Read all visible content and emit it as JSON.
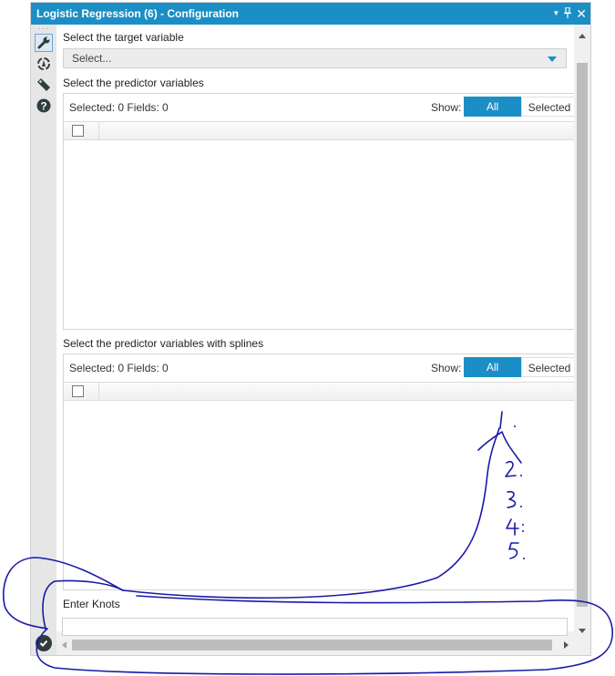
{
  "window": {
    "title": "Logistic Regression (6) - Configuration",
    "controls": [
      "dropdown-icon",
      "pin-icon",
      "close-icon"
    ],
    "accent_color": "#1b8fc5"
  },
  "left_tools": [
    {
      "icon": "wrench-icon",
      "active": true
    },
    {
      "icon": "connection-icon",
      "active": false
    },
    {
      "icon": "tag-icon",
      "active": false
    },
    {
      "icon": "help-icon",
      "active": false
    }
  ],
  "target": {
    "label": "Select the target variable",
    "select_value": "Select..."
  },
  "predictors": {
    "label": "Select the predictor variables",
    "status": "Selected: 0 Fields: 0",
    "show_label": "Show:",
    "show_all": "All",
    "show_selected": "Selected"
  },
  "splines": {
    "label": "Select the predictor variables with splines",
    "status": "Selected: 0 Fields: 0",
    "show_label": "Show:",
    "show_all": "All",
    "show_selected": "Selected"
  },
  "knots": {
    "label": "Enter Knots",
    "value": ""
  },
  "annotation": {
    "handwritten_numbers": [
      "1.",
      "2.",
      "3.",
      "4.",
      "5."
    ],
    "ink_color": "#1a1aa8"
  }
}
